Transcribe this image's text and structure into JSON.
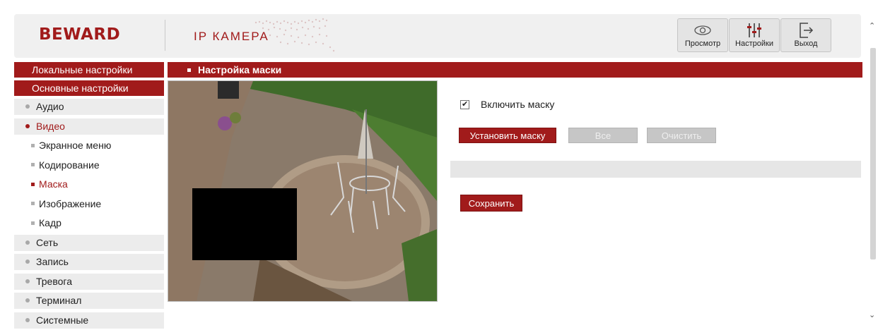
{
  "header": {
    "logo": "BEWARD",
    "subtitle": "IP КАМЕРА",
    "buttons": [
      {
        "label": "Просмотр",
        "icon": "eye-icon"
      },
      {
        "label": "Настройки",
        "icon": "sliders-icon"
      },
      {
        "label": "Выход",
        "icon": "exit-icon"
      }
    ]
  },
  "sidebar": {
    "local": "Локальные настройки",
    "basic": "Основные настройки",
    "items": [
      {
        "label": "Аудио"
      },
      {
        "label": "Видео"
      }
    ],
    "subitems": [
      {
        "label": "Экранное меню"
      },
      {
        "label": "Кодирование"
      },
      {
        "label": "Маска"
      },
      {
        "label": "Изображение"
      },
      {
        "label": "Кадр"
      }
    ],
    "items2": [
      {
        "label": "Сеть"
      },
      {
        "label": "Запись"
      },
      {
        "label": "Тревога"
      },
      {
        "label": "Терминал"
      },
      {
        "label": "Системные"
      }
    ]
  },
  "main": {
    "section_title": "Настройка маски",
    "enable_mask_label": "Включить маску",
    "enable_mask_checked": true,
    "set_mask_label": "Установить маску",
    "all_label": "Все",
    "clear_label": "Очистить",
    "save_label": "Сохранить"
  },
  "colors": {
    "accent": "#a11b1b",
    "sidebar_bg": "#ececec",
    "header_bg": "#f0f0f0"
  }
}
